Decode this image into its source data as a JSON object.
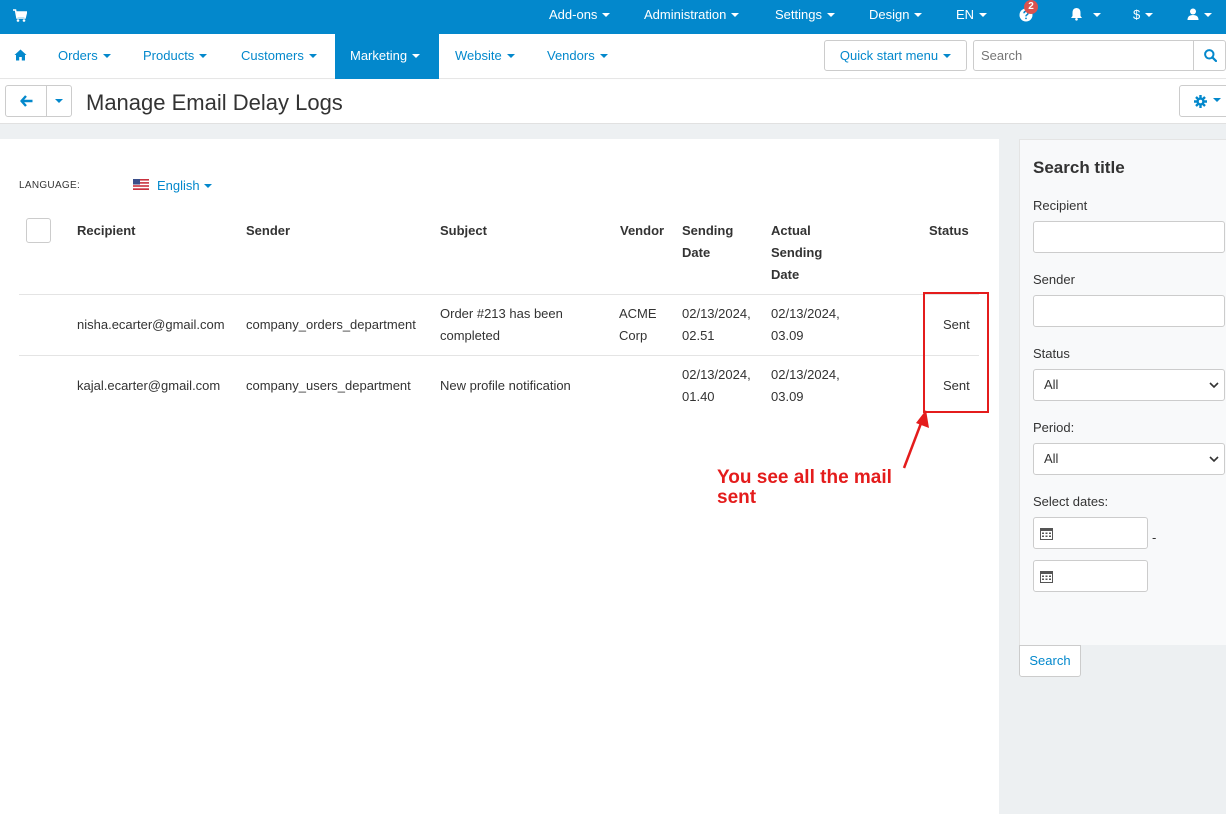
{
  "topbar": {
    "items": [
      "Add-ons",
      "Administration",
      "Settings",
      "Design",
      "EN"
    ],
    "notification_count": "2",
    "currency": "$"
  },
  "navbar": {
    "items": [
      "Orders",
      "Products",
      "Customers",
      "Marketing",
      "Website",
      "Vendors"
    ],
    "active": "Marketing",
    "quick_start": "Quick start menu",
    "search_placeholder": "Search"
  },
  "page": {
    "title": "Manage Email Delay Logs"
  },
  "language": {
    "label": "LANGUAGE:",
    "value": "English"
  },
  "table": {
    "headers": {
      "recipient": "Recipient",
      "sender": "Sender",
      "subject": "Subject",
      "vendor": "Vendor",
      "sending_date": "Sending Date",
      "actual_sending_date": "Actual Sending Date",
      "status": "Status"
    },
    "rows": [
      {
        "recipient": "nisha.ecarter@gmail.com",
        "sender": "company_orders_department",
        "subject": "Order #213 has been completed",
        "vendor": "ACME Corp",
        "sending_date": "02/13/2024, 02.51",
        "actual_sending_date": "02/13/2024, 03.09",
        "status": "Sent"
      },
      {
        "recipient": "kajal.ecarter@gmail.com",
        "sender": "company_users_department",
        "subject": "New profile notification",
        "vendor": "",
        "sending_date": "02/13/2024, 01.40",
        "actual_sending_date": "02/13/2024, 03.09",
        "status": "Sent"
      }
    ]
  },
  "annotation": {
    "text": "You see all the mail sent",
    "color": "#e41c1c"
  },
  "sidebar": {
    "title": "Search title",
    "recipient_label": "Recipient",
    "sender_label": "Sender",
    "status_label": "Status",
    "status_value": "All",
    "period_label": "Period:",
    "period_value": "All",
    "dates_label": "Select dates:",
    "dates_separator": "-",
    "search_button": "Search"
  },
  "colors": {
    "brand": "#0388cc",
    "background": "#edf0f2"
  }
}
